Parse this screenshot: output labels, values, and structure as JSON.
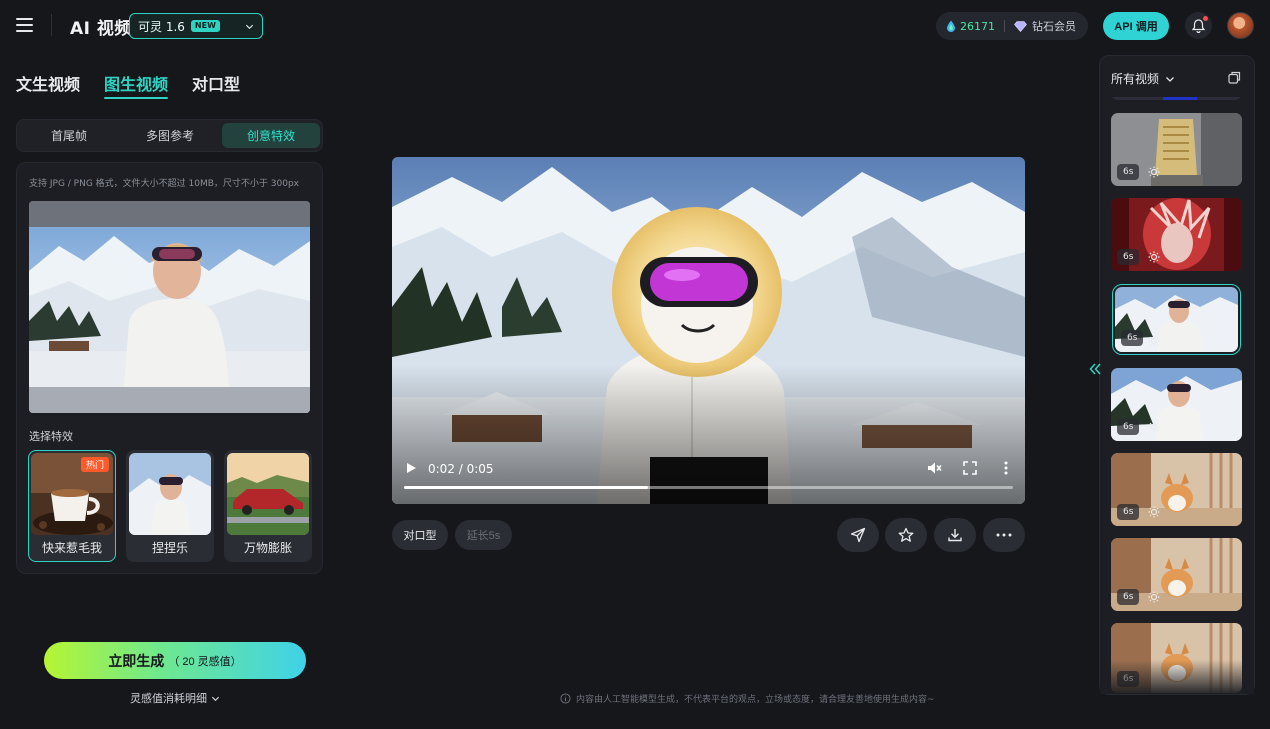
{
  "header": {
    "app_title": "AI 视频",
    "model_select": "可灵 1.6",
    "model_badge": "NEW",
    "credits": "26171",
    "membership": "钻石会员",
    "api_button": "API 调用"
  },
  "main_tabs": [
    {
      "label": "文生视频",
      "active": false
    },
    {
      "label": "图生视频",
      "active": true
    },
    {
      "label": "对口型",
      "active": false
    }
  ],
  "sub_tabs": [
    {
      "label": "首尾帧",
      "active": false
    },
    {
      "label": "多图参考",
      "active": false
    },
    {
      "label": "创意特效",
      "active": true
    }
  ],
  "upload": {
    "hint": "支持 JPG / PNG 格式，文件大小不超过 10MB，尺寸不小于 300px"
  },
  "effects": {
    "section_label": "选择特效",
    "items": [
      {
        "label": "快来惹毛我",
        "badge": "热门",
        "active": true
      },
      {
        "label": "捏捏乐",
        "active": false
      },
      {
        "label": "万物膨胀",
        "active": false
      }
    ]
  },
  "generate": {
    "label": "立即生成",
    "cost": "（  20 灵感值）",
    "consume_detail": "灵感值消耗明细"
  },
  "player": {
    "time": "0:02 / 0:05",
    "progress": 0.4
  },
  "actions": {
    "lip_sync": "对口型",
    "extend": "延长5s"
  },
  "history": {
    "title": "所有视频",
    "items": [
      {
        "duration": "6s",
        "active": false
      },
      {
        "duration": "6s",
        "active": false
      },
      {
        "duration": "6s",
        "active": true
      },
      {
        "duration": "6s",
        "active": false
      },
      {
        "duration": "6s",
        "active": false
      },
      {
        "duration": "6s",
        "active": false
      },
      {
        "duration": "6s",
        "active": false
      }
    ]
  },
  "disclaimer": "内容由人工智能模型生成，不代表平台的观点，立场或态度，请合理友善地使用生成内容~",
  "colors": {
    "accent": "#2fd3c2",
    "background": "#15171b",
    "panel": "#1c1e23"
  }
}
